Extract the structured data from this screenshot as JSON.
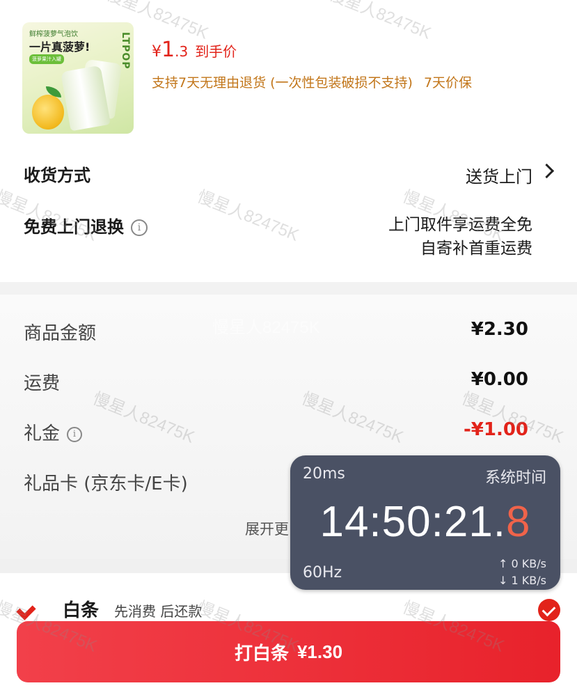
{
  "product": {
    "image_tag": "鲜榨菠萝气泡饮",
    "image_slogan": "一片真菠萝!",
    "image_pill": "菠萝果汁入罐",
    "image_brand": "LTPOP",
    "price_currency": "¥",
    "price_int": "1",
    "price_decimal": ".3",
    "price_suffix": "到手价",
    "policy_return": "支持7天无理由退货 (一次性包装破损不支持)",
    "policy_price": "7天价保"
  },
  "delivery": {
    "label": "收货方式",
    "value": "送货上门"
  },
  "free_return": {
    "label": "免费上门退换",
    "info_icon": "info-icon",
    "line1": "上门取件享运费全免",
    "line2": "自寄补首重运费"
  },
  "fees": {
    "goods_label": "商品金额",
    "goods_value": "¥2.30",
    "shipping_label": "运费",
    "shipping_value": "¥0.00",
    "gift_label": "礼金",
    "gift_value": "-¥1.00",
    "giftcard_label": "礼品卡 (京东卡/E卡)",
    "expand_label": "展开更"
  },
  "baitiao": {
    "title": "白条",
    "subtitle": "先消费 后还款"
  },
  "pay_button": {
    "label": "打白条",
    "amount": "¥1.30"
  },
  "overlay": {
    "latency": "20ms",
    "title": "系统时间",
    "time_main": "14:50:21.",
    "time_tenth": "8",
    "refresh": "60Hz",
    "upload": "↑ 0 KB/s",
    "download": "↓ 1 KB/s"
  },
  "watermark": "慢星人82475K",
  "colors": {
    "accent_red": "#e2231a",
    "policy_orange": "#c2761a",
    "overlay_bg": "#4a5164"
  }
}
